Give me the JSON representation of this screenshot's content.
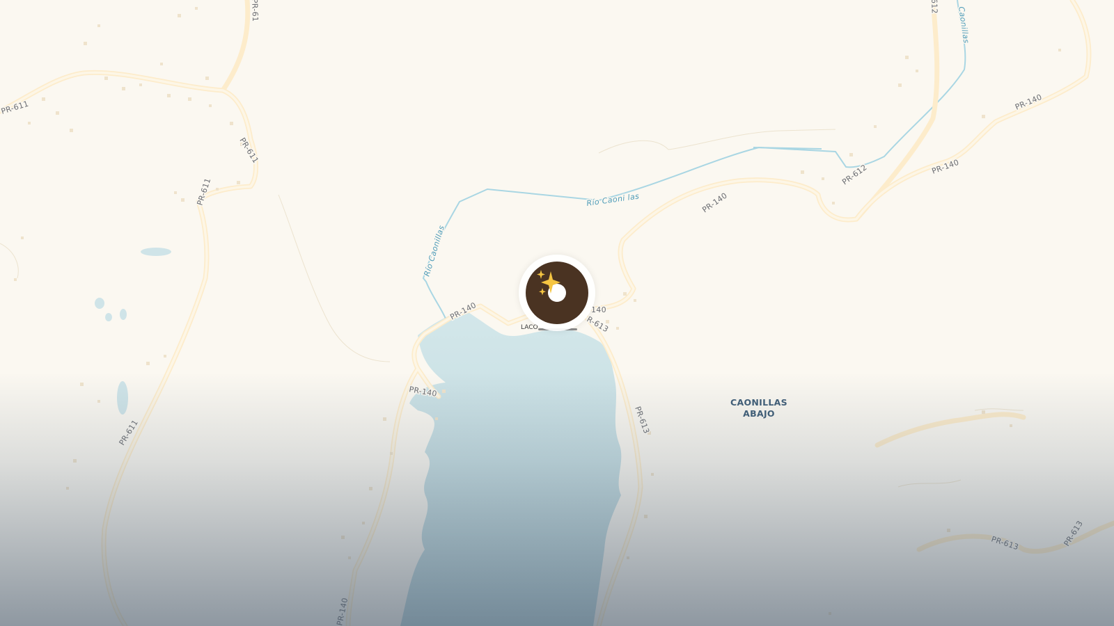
{
  "map": {
    "place_label": {
      "line1": "CAONILLAS",
      "line2": "ABAJO"
    },
    "poi_label": "LACO",
    "road_labels": [
      {
        "id": "pr611-a",
        "text": "PR-611"
      },
      {
        "id": "pr611-b",
        "text": "PR-611"
      },
      {
        "id": "pr611-c",
        "text": "PR-611"
      },
      {
        "id": "pr611-d",
        "text": "PR-611"
      },
      {
        "id": "pr140-a",
        "text": "PR-140"
      },
      {
        "id": "pr140-b",
        "text": "PR-140"
      },
      {
        "id": "pr140-c",
        "text": "PR-140"
      },
      {
        "id": "pr140-d",
        "text": "PR-140"
      },
      {
        "id": "pr140-e",
        "text": "PR-140"
      },
      {
        "id": "pr140-f",
        "text": "140"
      },
      {
        "id": "pr140-g",
        "text": "PR-140"
      },
      {
        "id": "pr612",
        "text": "PR-612"
      },
      {
        "id": "pr613-a",
        "text": "R-613"
      },
      {
        "id": "pr613-b",
        "text": "PR-613"
      },
      {
        "id": "pr613-c",
        "text": "PR-613"
      },
      {
        "id": "pr613-d",
        "text": "PR-613"
      },
      {
        "id": "pr61-top",
        "text": "PR-61"
      },
      {
        "id": "pr612-top",
        "text": "612"
      }
    ],
    "river_labels": [
      {
        "id": "rio-a",
        "text": "Río Caoni las"
      },
      {
        "id": "rio-b",
        "text": "Río Caonillas"
      },
      {
        "id": "rio-c",
        "text": "Caonillas"
      }
    ],
    "marker": {
      "icon": "sparkle-icon",
      "color": "#4a3322"
    }
  },
  "colors": {
    "land": "#fbf8f1",
    "water": "#cfe4e8",
    "road": "#fdf3dc",
    "river": "#a9d6e3",
    "marker": "#4a3322"
  }
}
